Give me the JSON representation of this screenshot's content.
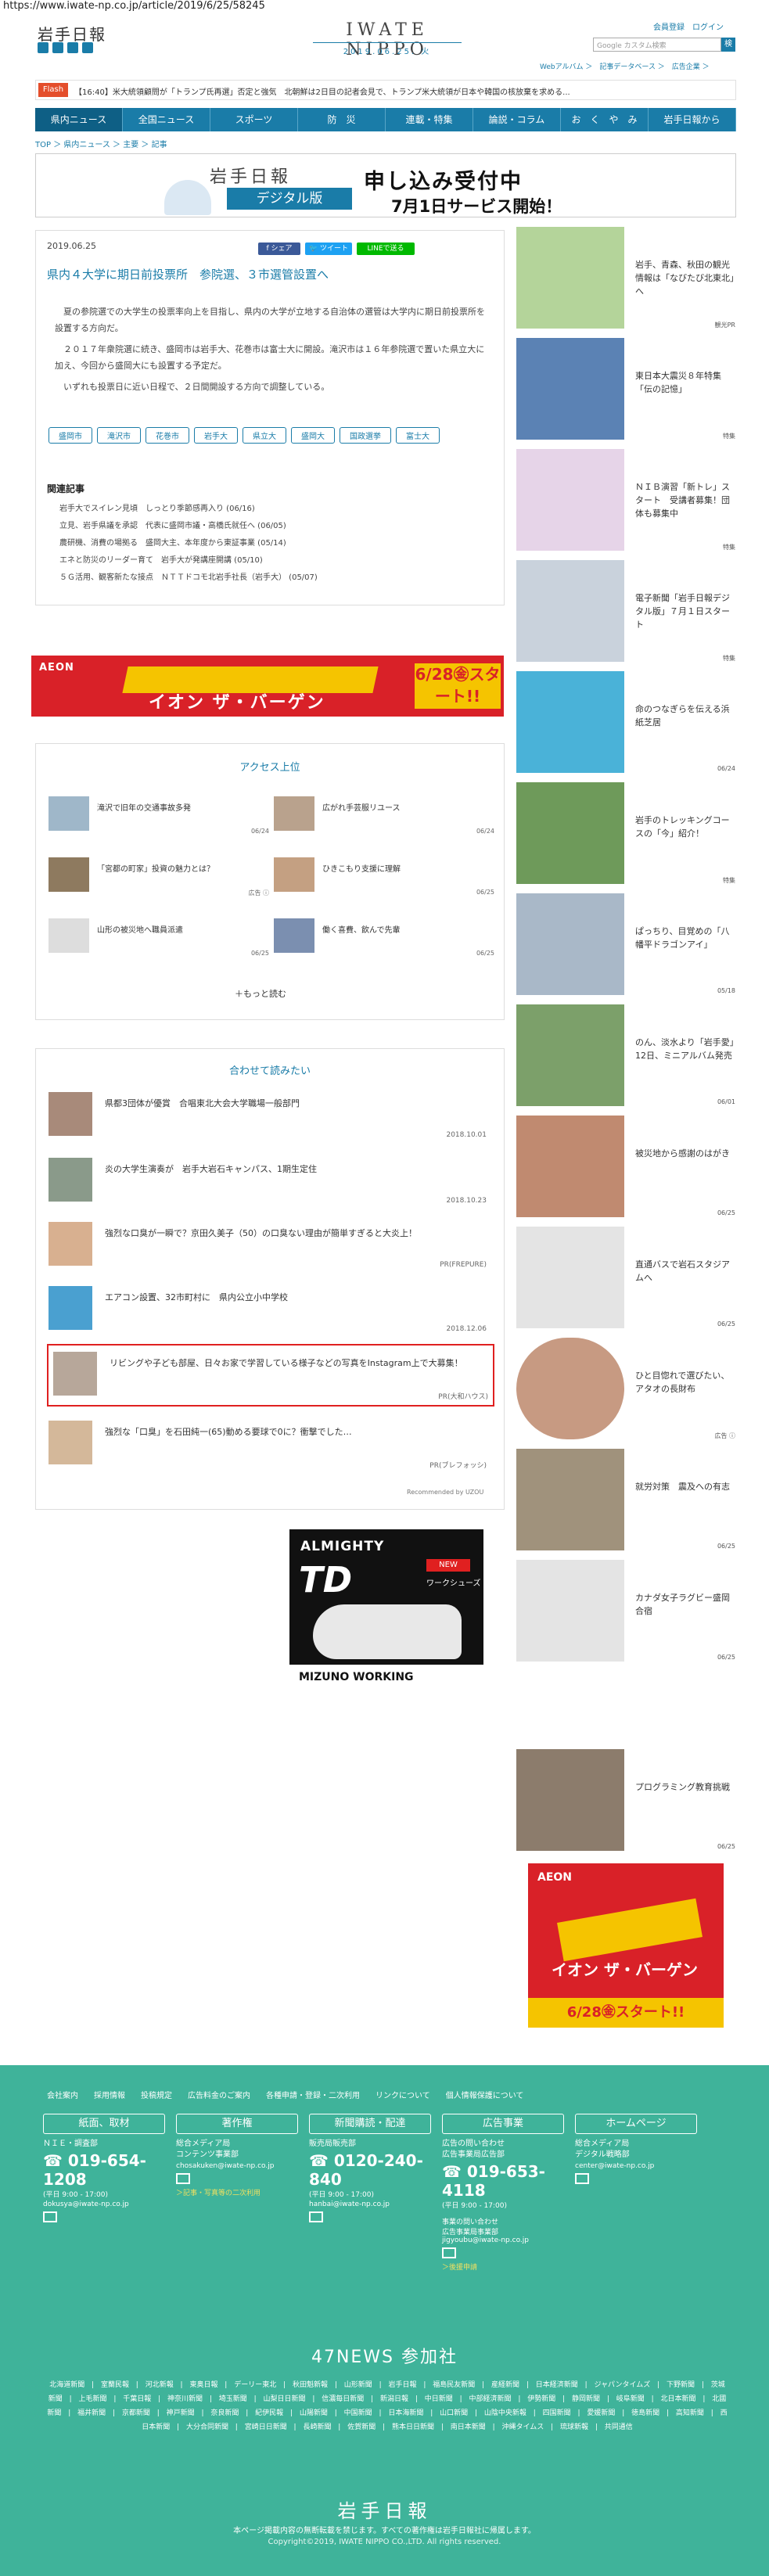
{
  "browser": {
    "url": "https://www.iwate-np.co.jp/article/2019/6/25/58245"
  },
  "header": {
    "logo": "岩手日報",
    "brand": "IWATE NIPPO",
    "date": "2019.06.25. 火",
    "member_links": "会員登録　ログイン",
    "search_placeholder": "Google カスタム検索",
    "search_button": "検",
    "sublinks": "Webアルバム ＞　記事データベース ＞　広告企業 ＞"
  },
  "flash": {
    "label": "Flash",
    "text": "【16:40】米大統領顧問が「トランプ氏再選」否定と強気　北朝鮮は2日目の記者会見で、トランプ米大統領が日本や韓国の核放棄を求める..."
  },
  "nav": {
    "items": [
      "県内ニュース",
      "全国ニュース",
      "スポーツ",
      "防　災",
      "連載・特集",
      "論説・コラム",
      "お　く　や　み",
      "岩手日報から"
    ]
  },
  "breadcrumb": "TOP ＞ 県内ニュース ＞ 主要 ＞ 記事",
  "banner": {
    "logo": "岩手日報",
    "digital": "デジタル版",
    "main": "申し込み受付中",
    "sub": "7月1日サービス開始！"
  },
  "article": {
    "date": "2019.06.25",
    "share": [
      "f シェア",
      "🐦 ツイート",
      "LINEで送る"
    ],
    "title": "県内４大学に期日前投票所　参院選、３市選管設置へ",
    "paragraphs": [
      "夏の参院選での大学生の投票率向上を目指し、県内の大学が立地する自治体の選管は大学内に期日前投票所を設置する方向だ。",
      "２０１７年衆院選に続き、盛岡市は岩手大、花巻市は富士大に開設。滝沢市は１６年参院選で置いた県立大に加え、今回から盛岡大にも設置する予定だ。",
      "いずれも投票日に近い日程で、２日間開設する方向で調整している。"
    ],
    "tags": [
      "盛岡市",
      "滝沢市",
      "花巻市",
      "岩手大",
      "県立大",
      "盛岡大",
      "国政選挙",
      "富士大"
    ],
    "related_heading": "関連記事",
    "related": [
      "岩手大でスイレン見頃　しっとり季節感再入り (06/16)",
      "立見、岩手県議を承認　代表に盛岡市議・高橋氏就任へ (06/05)",
      "農研機、消費の場拠る　盛岡大主、本年度から東証事業 (05/14)",
      "エネと防災のリーダー育て　岩手大が発講座開講 (05/10)",
      "５Ｇ活用、観客新たな接点　ＮＴＴドコモ北岩手社長（岩手大） (05/07)"
    ]
  },
  "ad_banner": {
    "logo": "AEON",
    "text": "イオン ザ・バーゲン",
    "date": "6/28㊎スタート!!"
  },
  "access": {
    "heading": "アクセス上位",
    "items": [
      {
        "title": "滝沢で旧年の交通事故多発",
        "date": "06/24"
      },
      {
        "title": "広がれ手芸服リユース",
        "date": "06/24"
      },
      {
        "title": "「宮都の町家」投資の魅力とは？",
        "date": "広告 ⓘ"
      },
      {
        "title": "ひきこもり支援に理解",
        "date": "06/25"
      },
      {
        "title": "山形の被災地へ職員派遣",
        "date": "06/25"
      },
      {
        "title": "働く喜費、飲んで先輩",
        "date": "06/25"
      }
    ],
    "more": "＋もっと読む"
  },
  "readalso": {
    "heading": "合わせて読みたい",
    "items": [
      {
        "title": "県都3団体が優賞　合唱東北大会大学職場一般部門",
        "date": "2018.10.01"
      },
      {
        "title": "炎の大学生演奏が　岩手大岩石キャンパス、1期生定住",
        "date": "2018.10.23"
      },
      {
        "title": "強烈な口臭が一瞬で？京田久美子（50）の口臭ない理由が簡単すぎると大炎上！",
        "date": "PR(FREPURE)"
      },
      {
        "title": "エアコン設置、32市町村に　県内公立小中学校",
        "date": "2018.12.06"
      },
      {
        "title": "リビングや子ども部屋、日々お家で学習している様子などの写真をInstagram上で大募集！",
        "date": "PR(大和ハウス)"
      },
      {
        "title": "強烈な「口臭」を石田純一(65)動める要球で0に？衝撃でした…",
        "date": "PR(ブレフォッシ)"
      }
    ],
    "powered": "Recommended by UZOU"
  },
  "sq_ad": {
    "brand": "ALMIGHTY",
    "model": "TD",
    "badge": "NEW",
    "series": "ワークシューズ",
    "footer": "MIZUNO WORKING"
  },
  "sidebar": [
    {
      "title": "岩手、青森、秋田の観光情報は「なびたび北東北」へ",
      "date": "観光PR"
    },
    {
      "title": "東日本大震災８年特集「伝の記憶」",
      "date": "特集"
    },
    {
      "title": "ＮＩＢ演習「新トレ」スタート　受講者募集！団体も募集中",
      "date": "特集"
    },
    {
      "title": "電子新聞「岩手日報デジタル版」７月１日スタート",
      "date": "特集"
    },
    {
      "title": "命のつなぎらを伝える浜紙芝居",
      "date": "06/24"
    },
    {
      "title": "岩手のトレッキングコースの「今」紹介！",
      "date": "特集"
    },
    {
      "title": "ぱっちり、目覚めの「八幡平ドラゴンアイ」",
      "date": "05/18"
    },
    {
      "title": "のん、淡水より「岩手愛」　12日、ミニアルバム発売",
      "date": "06/01"
    },
    {
      "title": "被災地から感謝のはがき",
      "date": "06/25"
    },
    {
      "title": "直通バスで岩石スタジアムへ",
      "date": "06/25"
    },
    {
      "title": "ひと目惚れで選びたい、アタオの長財布",
      "date": "広告 ⓘ"
    },
    {
      "title": "就労対策　震及への有志",
      "date": "06/25"
    },
    {
      "title": "カナダ女子ラグビー盛岡合宿",
      "date": "06/25"
    },
    {
      "title": "プログラミング教育挑戦",
      "date": "06/25"
    }
  ],
  "side_ad": {
    "logo": "AEON",
    "text": "イオン ザ・バーゲン",
    "date": "6/28㊎スタート!!"
  },
  "footer": {
    "links": [
      "会社案内",
      "採用情報",
      "投稿規定",
      "広告料金のご案内",
      "各種申請・登録・二次利用",
      "リンクについて",
      "個人情報保護について"
    ],
    "boxes": [
      {
        "head": "紙面、取材",
        "sub": "ＮＩＥ・調査部",
        "phone": "019-654-1208",
        "hours": "(平日 9:00 - 17:00)",
        "email": "dokusya@iwate-np.co.jp",
        "extra": ""
      },
      {
        "head": "著作権",
        "sub": "総合メディア局\nコンテンツ事業部",
        "phone": "",
        "hours": "",
        "email": "chosakuken@iwate-np.co.jp",
        "extra": "＞記事・写真等の二次利用"
      },
      {
        "head": "新聞購読・配達",
        "sub": "販売局販売部",
        "phone": "0120-240-840",
        "hours": "(平日 9:00 - 17:00)",
        "email": "hanbai@iwate-np.co.jp",
        "extra": ""
      },
      {
        "head": "広告事業",
        "sub": "広告の問い合わせ\n広告事業局広告部",
        "phone": "019-653-4118",
        "hours": "(平日 9:00 - 17:00)",
        "email": "事業の問い合わせ\n広告事業局事業部\njigyoubu@iwate-np.co.jp",
        "extra": "＞後援申請"
      },
      {
        "head": "ホームページ",
        "sub": "総合メディア局\nデジタル戦略部",
        "phone": "",
        "hours": "",
        "email": "center@iwate-np.co.jp",
        "extra": ""
      }
    ],
    "news47": "47NEWS 参加社",
    "papers": "北海道新聞 | 室蘭民報 | 河北新報 | 東奥日報 | デーリー東北 | 秋田魁新報 | 山形新聞 | 岩手日報 | 福島民友新聞 | 産経新聞 | 日本経済新聞 | ジャパンタイムズ | 下野新聞 | 茨城新聞 | 上毛新聞 | 千葉日報 | 神奈川新聞 | 埼玉新聞 | 山梨日日新聞 | 信濃毎日新聞 | 新潟日報 | 中日新聞 | 中部経済新聞 | 伊勢新聞 | 静岡新聞 | 岐阜新聞 | 北日本新聞 | 北國新聞 | 福井新聞 | 京都新聞 | 神戸新聞 | 奈良新聞 | 紀伊民報 | 山陽新聞 | 中国新聞 | 日本海新聞 | 山口新聞 | 山陰中央新報 | 四国新聞 | 愛媛新聞 | 徳島新聞 | 高知新聞 | 西日本新聞 | 大分合同新聞 | 宮崎日日新聞 | 長崎新聞 | 佐賀新聞 | 熊本日日新聞 | 南日本新聞 | 沖縄タイムス | 琉球新報 | 共同通信",
    "logo": "岩手日報",
    "notice": "本ページ掲載内容の無断転載を禁じます。すべての著作権は岩手日報社に帰属します。",
    "copyright": "Copyright©2019, IWATE NIPPO CO.,LTD. All rights reserved."
  },
  "colors": {
    "brand": "#1a7ca8",
    "footer": "#3fb39a",
    "ad_red": "#d92128",
    "ad_yellow": "#f5c400"
  }
}
